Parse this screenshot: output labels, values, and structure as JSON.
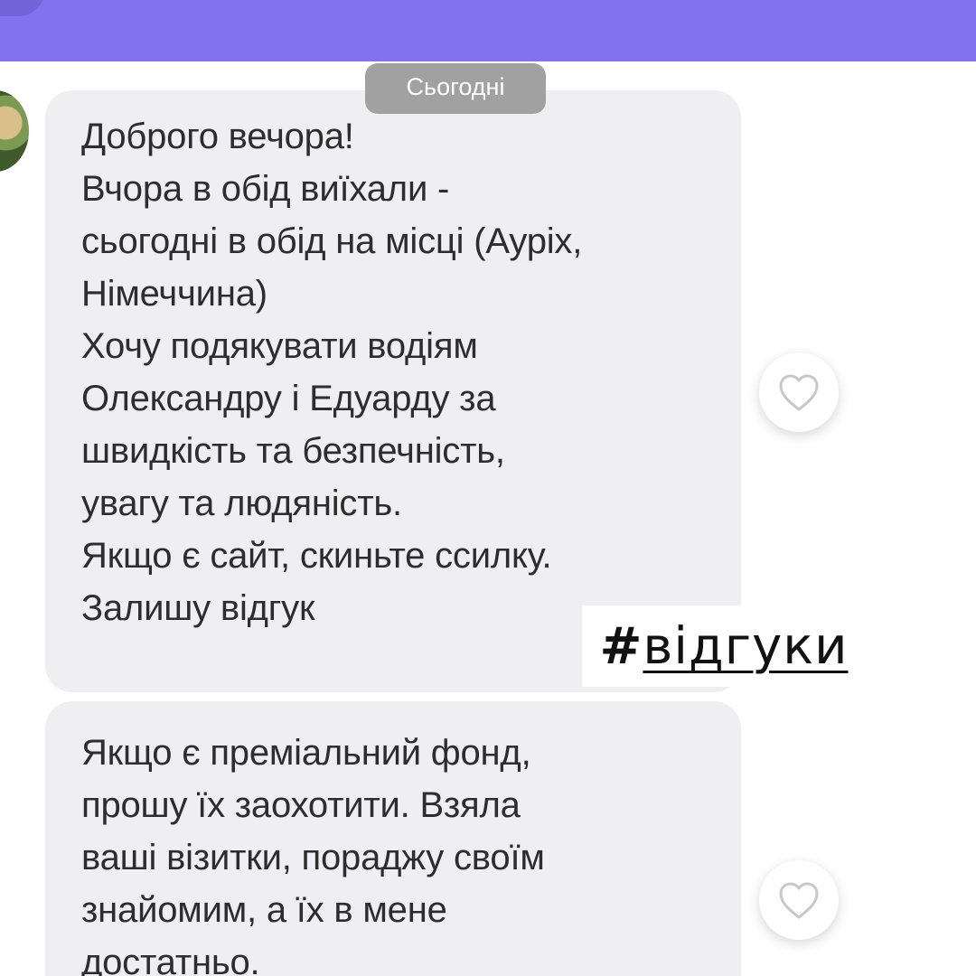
{
  "header": {
    "accent_color": "#8272ee"
  },
  "chat": {
    "date_separator": "Сьогодні",
    "messages": [
      {
        "text": "Доброго вечора!\nВчора в обід виїхали -\nсьогодні в обід на місці (Ауріх,\nНімеччина)\nХочу подякувати водіям\nОлександру і Едуарду за\nшвидкість та безпечність,\nувагу та людяність.\nЯкщо є сайт, скиньте ссилку.\nЗалишу відгук",
        "reaction_icon": "heart-outline-icon"
      },
      {
        "text": "Якщо є преміальний фонд,\nпрошу їх заохотити. Взяла\nваші візитки, пораджу своїм\nзнайомим, а їх в мене\nдостатньо.",
        "reaction_icon": "heart-outline-icon"
      }
    ]
  },
  "overlay": {
    "hash": "#",
    "word": "відгуки"
  }
}
